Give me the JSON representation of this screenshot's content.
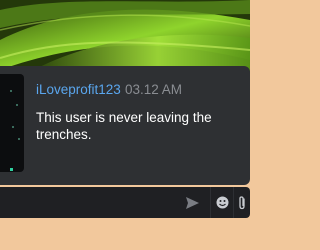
{
  "message": {
    "username": "iLoveprofit123",
    "timestamp": "03.12 AM",
    "text": "This user is never leaving the trenches."
  },
  "input_bar": {
    "icons": [
      "send-icon",
      "emoji-icon",
      "attachment-icon"
    ]
  },
  "colors": {
    "username": "#5aa6ee",
    "timestamp": "#8a8d92",
    "panel": "#2e3033",
    "input_bar": "#1f2023",
    "border_frame": "#f2c89c",
    "wallpaper_green": "#7cc82a"
  }
}
